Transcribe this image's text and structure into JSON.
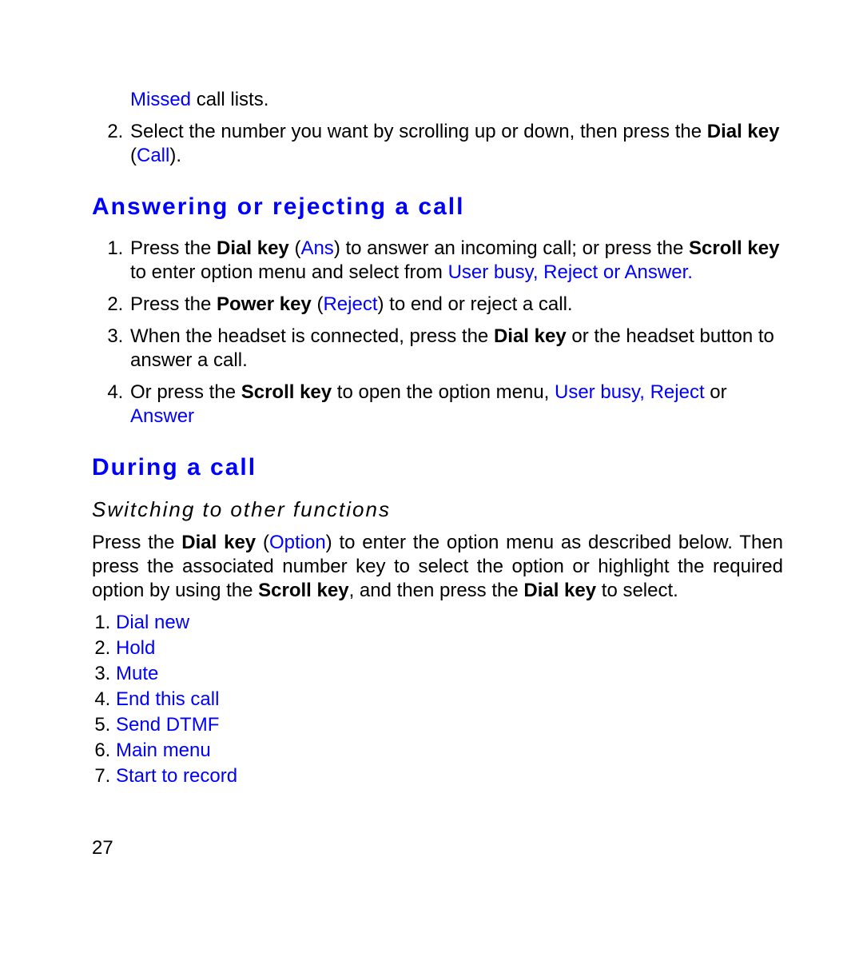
{
  "intro": {
    "line1_blue": "Missed",
    "line1_rest": " call lists.",
    "item2_a": "Select the number you want by scrolling up or down, then press the ",
    "item2_bold": "Dial key",
    "item2_paren_open": " (",
    "item2_call": "Call",
    "item2_paren_close": ")."
  },
  "section1": {
    "heading": "Answering or rejecting a call",
    "items": {
      "i1_a": "Press the ",
      "i1_bold1": "Dial key",
      "i1_b": " (",
      "i1_blue1": "Ans",
      "i1_c": ") to answer an incoming call; or press the ",
      "i1_bold2": "Scroll key",
      "i1_d": " to enter option menu and select from ",
      "i1_blue2": "User busy, Reject or Answer.",
      "i2_a": "Press the ",
      "i2_bold": "Power key",
      "i2_b": " (",
      "i2_blue": "Reject",
      "i2_c": ") to end or reject a call.",
      "i3_a": "When the headset is connected, press the ",
      "i3_bold": "Dial key",
      "i3_b": " or the headset button to answer a call.",
      "i4_a": "Or press the ",
      "i4_bold": "Scroll key",
      "i4_b": " to open the option menu, ",
      "i4_blue1": "User busy, Reject",
      "i4_c": " or ",
      "i4_blue2": "Answer"
    }
  },
  "section2": {
    "heading": "During a call",
    "subheading": "Switching to other functions",
    "para_a": "Press the ",
    "para_bold1": "Dial key",
    "para_b": " (",
    "para_blue": "Option",
    "para_c": ") to enter the option menu as described below. Then press the associated number key to select the option or highlight the required option by using the ",
    "para_bold2": "Scroll key",
    "para_d": ", and then press the ",
    "para_bold3": "Dial key",
    "para_e": " to select.",
    "options": [
      "Dial new",
      "Hold",
      "Mute",
      "End this call",
      "Send DTMF",
      "Main menu",
      "Start to record"
    ]
  },
  "page_number": "27"
}
